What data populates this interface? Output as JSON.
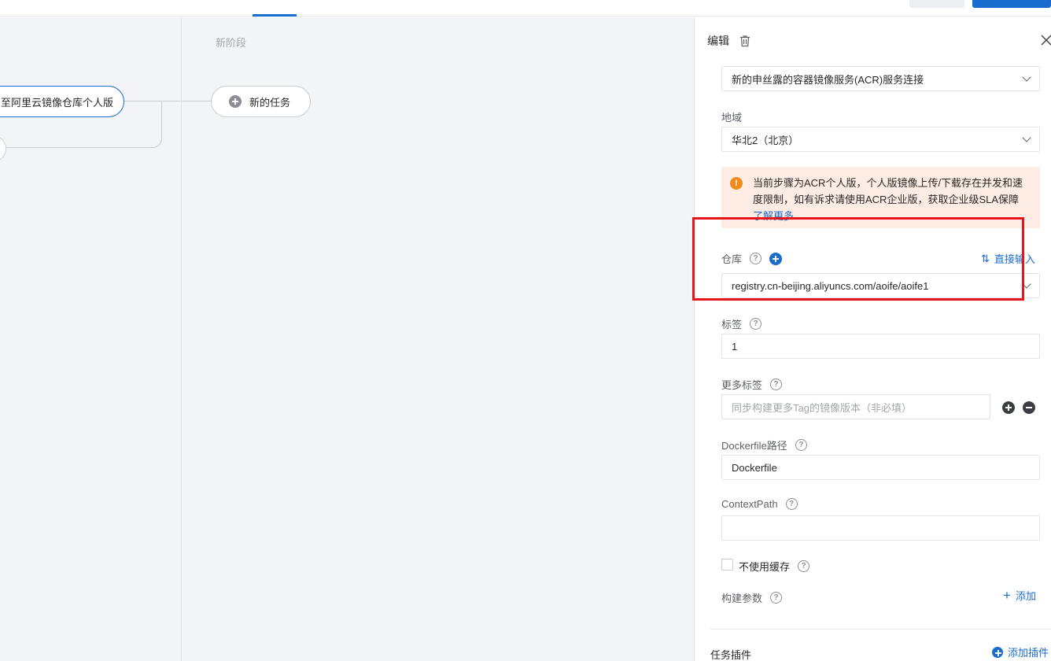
{
  "canvas": {
    "stage_title": "新阶段",
    "task_node_label": "至阿里云镜像仓库个人版",
    "new_task_label": "新的任务"
  },
  "panel": {
    "title": "编辑",
    "connection_value": "新的申丝露的容器镜像服务(ACR)服务连接",
    "region_label": "地域",
    "region_value": "华北2（北京）",
    "warning_text_1": "当前步骤为ACR个人版，个人版镜像上传/下载存在并发和速度限制，如有诉求请使用ACR企业版，获取企业级SLA保障",
    "warning_link": "了解更多",
    "repo_label": "仓库",
    "direct_input_label": "直接输入",
    "repo_value": "registry.cn-beijing.aliyuncs.com/aoife/aoife1",
    "tag_label": "标签",
    "tag_value": "1",
    "more_tags_label": "更多标签",
    "more_tags_placeholder": "同步构建更多Tag的镜像版本（非必填）",
    "dockerfile_label": "Dockerfile路径",
    "dockerfile_value": "Dockerfile",
    "context_label": "ContextPath",
    "context_value": "",
    "no_cache_label": "不使用缓存",
    "build_args_label": "构建参数",
    "add_label": "添加",
    "plugins_label": "任务插件",
    "add_plugin_label": "添加插件"
  },
  "colors": {
    "accent": "#1b6ccf",
    "warning_bg": "#fdece4",
    "warning_icon": "#f08a1c",
    "highlight": "#e8141b"
  }
}
